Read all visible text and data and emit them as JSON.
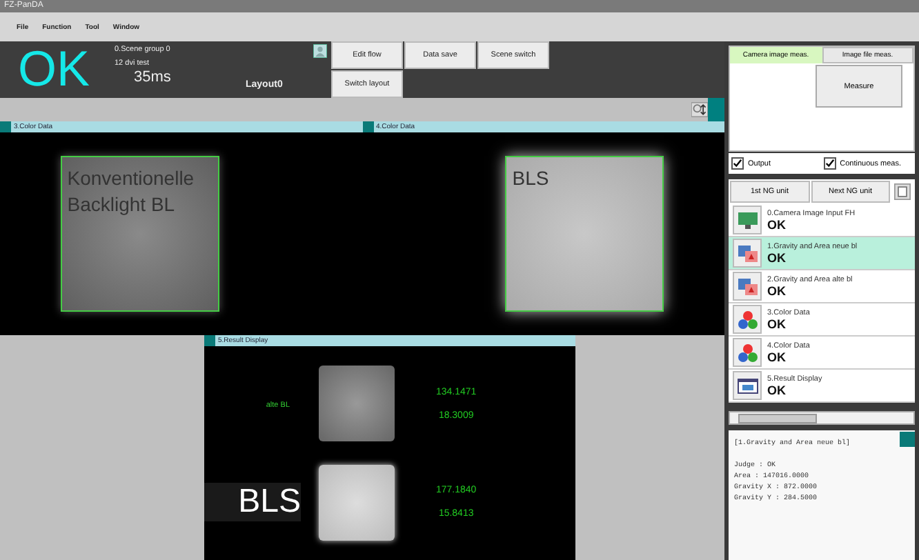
{
  "window": {
    "title": "FZ-PanDA"
  },
  "menu": [
    "File",
    "Function",
    "Tool",
    "Window"
  ],
  "header": {
    "judge": "OK",
    "scene_group": "0.Scene group 0",
    "scene": "12 dvi test",
    "time": "35ms",
    "layout": "Layout0"
  },
  "toolbar_buttons": [
    "Edit flow",
    "Data save",
    "Scene switch",
    "Switch layout"
  ],
  "panels": [
    {
      "title": "3.Color Data",
      "label": "Konventionelle Backlight BL",
      "kind": "dim"
    },
    {
      "title": "4.Color Data",
      "label": "BLS",
      "kind": "bright"
    }
  ],
  "result_display": {
    "title": "5.Result Display",
    "rows": [
      {
        "label": "alte BL",
        "kind": "small",
        "value_1": "134.1471",
        "value_2": "18.3009"
      },
      {
        "label": "BLS",
        "kind": "large",
        "value_1": "177.1840",
        "value_2": "15.8413"
      }
    ]
  },
  "meas_tabs": [
    {
      "label": "Camera image meas.",
      "selected": true
    },
    {
      "label": "Image file meas.",
      "selected": false
    }
  ],
  "measure_button": "Measure",
  "options": [
    {
      "label": "Output",
      "checked": true
    },
    {
      "label": "Continuous meas.",
      "checked": true
    }
  ],
  "ng_buttons": [
    "1st NG unit",
    "Next NG unit"
  ],
  "flow": [
    {
      "name": "0.Camera Image Input FH",
      "result": "OK",
      "selected": false,
      "kind": "camera"
    },
    {
      "name": "1.Gravity and Area neue bl",
      "result": "OK",
      "selected": true,
      "kind": "gravity"
    },
    {
      "name": "2.Gravity and Area alte bl",
      "result": "OK",
      "selected": false,
      "kind": "gravity"
    },
    {
      "name": "3.Color Data",
      "result": "OK",
      "selected": false,
      "kind": "color"
    },
    {
      "name": "4.Color Data",
      "result": "OK",
      "selected": false,
      "kind": "color"
    },
    {
      "name": "5.Result Display",
      "result": "OK",
      "selected": false,
      "kind": "display"
    }
  ],
  "detail": {
    "title": "[1.Gravity and Area neue bl]",
    "lines": [
      "Judge : OK",
      "Area : 147016.0000",
      "Gravity X : 872.0000",
      "Gravity Y : 284.5000"
    ]
  }
}
